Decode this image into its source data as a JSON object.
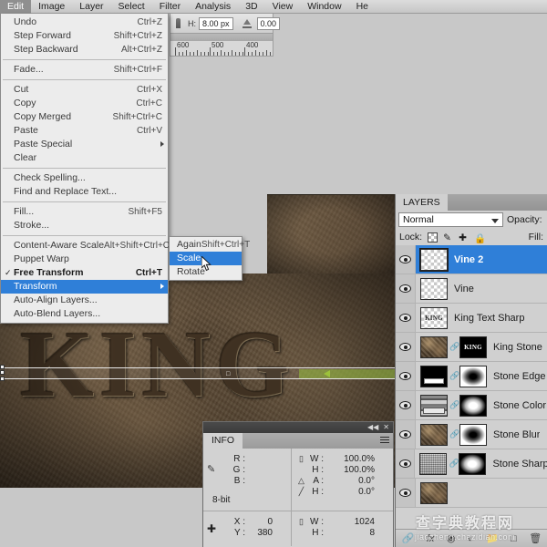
{
  "app": {
    "name": "Adobe Photoshop"
  },
  "menubar": {
    "items": [
      {
        "label": "Edit",
        "active": true
      },
      {
        "label": "Image",
        "active": false
      },
      {
        "label": "Layer",
        "active": false
      },
      {
        "label": "Select",
        "active": false
      },
      {
        "label": "Filter",
        "active": false
      },
      {
        "label": "Analysis",
        "active": false
      },
      {
        "label": "3D",
        "active": false
      },
      {
        "label": "View",
        "active": false
      },
      {
        "label": "Window",
        "active": false
      },
      {
        "label": "He",
        "active": false
      }
    ]
  },
  "options_bar": {
    "brush_icon": "brush-icon",
    "hardness_label": "H:",
    "hardness_value": "8.00 px",
    "angle_icon": "angle-icon",
    "angle_value": "0.00"
  },
  "ruler": {
    "labels": [
      "600",
      "500",
      "400"
    ]
  },
  "edit_menu": {
    "rows": [
      {
        "label": "Undo",
        "key": "Ctrl+Z"
      },
      {
        "label": "Step Forward",
        "key": "Shift+Ctrl+Z"
      },
      {
        "label": "Step Backward",
        "key": "Alt+Ctrl+Z"
      },
      {
        "sep": true
      },
      {
        "label": "Fade...",
        "key": "Shift+Ctrl+F"
      },
      {
        "sep": true
      },
      {
        "label": "Cut",
        "key": "Ctrl+X"
      },
      {
        "label": "Copy",
        "key": "Ctrl+C"
      },
      {
        "label": "Copy Merged",
        "key": "Shift+Ctrl+C"
      },
      {
        "label": "Paste",
        "key": "Ctrl+V"
      },
      {
        "label": "Paste Special",
        "key": "",
        "arrow": true
      },
      {
        "label": "Clear",
        "key": ""
      },
      {
        "sep": true
      },
      {
        "label": "Check Spelling...",
        "key": ""
      },
      {
        "label": "Find and Replace Text...",
        "key": ""
      },
      {
        "sep": true
      },
      {
        "label": "Fill...",
        "key": "Shift+F5"
      },
      {
        "label": "Stroke...",
        "key": ""
      },
      {
        "sep": true
      },
      {
        "label": "Content-Aware Scale",
        "key": "Alt+Shift+Ctrl+C"
      },
      {
        "label": "Puppet Warp",
        "key": ""
      },
      {
        "label": "Free Transform",
        "key": "Ctrl+T",
        "checked": true,
        "bold": true
      },
      {
        "label": "Transform",
        "key": "",
        "arrow": true,
        "highlighted": true
      },
      {
        "label": "Auto-Align Layers...",
        "key": ""
      },
      {
        "label": "Auto-Blend Layers...",
        "key": ""
      }
    ]
  },
  "transform_submenu": {
    "rows": [
      {
        "label": "Again",
        "key": "Shift+Ctrl+T"
      },
      {
        "label": "Scale",
        "key": "",
        "highlighted": true
      },
      {
        "label": "Rotate",
        "key": ""
      }
    ]
  },
  "canvas": {
    "artwork_text": "KING",
    "description": "stone-texture-king-engraving"
  },
  "info_panel": {
    "tab_label": "INFO",
    "collapse_icon": "collapse-icon",
    "close_icon": "close-icon",
    "menu_icon": "panel-menu-icon",
    "eyedropper_icon": "eyedropper-icon",
    "color_rows": [
      {
        "key": "R :",
        "value": ""
      },
      {
        "key": "G :",
        "value": ""
      },
      {
        "key": "B :",
        "value": ""
      }
    ],
    "bit_depth": "8-bit",
    "transform_rows": [
      {
        "icon": "scale-icon",
        "key": "W :",
        "value": "100.0%"
      },
      {
        "icon": "",
        "key": "H :",
        "value": "100.0%"
      },
      {
        "icon": "angle-icon",
        "key": "A :",
        "value": "0.0°"
      },
      {
        "icon": "skew-icon",
        "key": "H :",
        "value": "0.0°"
      }
    ],
    "position_icon": "crosshair-icon",
    "position_rows": [
      {
        "key": "X :",
        "value": "0"
      },
      {
        "key": "Y :",
        "value": "380"
      }
    ],
    "size_icon": "selection-size-icon",
    "size_rows": [
      {
        "key": "W :",
        "value": "1024"
      },
      {
        "key": "H :",
        "value": "8"
      }
    ]
  },
  "layers_panel": {
    "tab_label": "LAYERS",
    "blend_mode": "Normal",
    "blend_caret_icon": "chevron-down-icon",
    "opacity_label": "Opacity:",
    "lock_label": "Lock:",
    "fill_label": "Fill:",
    "lock_icons": [
      "lock-transparent-pixels-icon",
      "lock-image-pixels-icon",
      "lock-position-icon",
      "lock-all-icon"
    ],
    "layers": [
      {
        "name": "Vine 2",
        "visible": true,
        "selected": true,
        "thumb": "checker",
        "mask": null,
        "link": false
      },
      {
        "name": "Vine",
        "visible": true,
        "selected": false,
        "thumb": "checker",
        "mask": null,
        "link": false
      },
      {
        "name": "King Text Sharp",
        "visible": true,
        "selected": false,
        "thumb": "kingtext",
        "mask": null,
        "link": false
      },
      {
        "name": "King Stone",
        "visible": true,
        "selected": false,
        "thumb": "stonetex",
        "mask": "kingmask",
        "link": true
      },
      {
        "name": "Stone Edge",
        "visible": true,
        "selected": false,
        "thumb": "blackbar",
        "mask": "normal",
        "link": true
      },
      {
        "name": "Stone Color",
        "visible": true,
        "selected": false,
        "thumb": "curves",
        "mask": "inv",
        "link": true
      },
      {
        "name": "Stone Blur",
        "visible": true,
        "selected": false,
        "thumb": "stonetex",
        "mask": "normal",
        "link": true
      },
      {
        "name": "Stone Sharp",
        "visible": true,
        "selected": false,
        "thumb": "noise",
        "mask": "inv",
        "link": true
      },
      {
        "name": "",
        "visible": true,
        "selected": false,
        "thumb": "stonetex",
        "mask": null,
        "link": false
      }
    ],
    "bottom_icons": [
      "link-layers-icon",
      "layer-style-icon",
      "layer-mask-icon",
      "adjustment-layer-icon",
      "new-group-icon",
      "new-layer-icon",
      "delete-layer-icon"
    ]
  },
  "watermark": {
    "chinese": "查字典教程网",
    "url": "jiaocheng.chazidian.com"
  },
  "colors": {
    "selection_blue": "#2f7fd8",
    "panel_grey": "#d0d0d0",
    "menu_grey": "#ececec",
    "dark_bar": "#4a4a4a",
    "green_marquee": "#9cc23a"
  }
}
